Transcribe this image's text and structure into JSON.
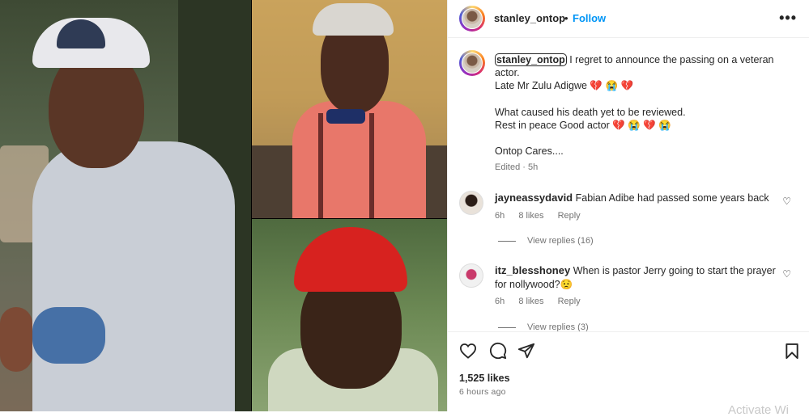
{
  "post": {
    "author": "stanley_ontop",
    "separator": "•",
    "follow_label": "Follow",
    "more_icon": "more-options-icon",
    "caption": {
      "author": "stanley_ontop",
      "line1": " I regret to announce the passing on a veteran actor.",
      "line2": "Late Mr Zulu Adigwe 💔 😭 💔",
      "line3": "What caused his death yet to be reviewed.",
      "line4": "Rest in peace Good actor 💔 😭 💔 😭",
      "line5": "Ontop Cares....",
      "meta": "Edited · 5h"
    },
    "comments": [
      {
        "user": "jayneassydavid",
        "text": "Fabian Adibe had passed some years back",
        "time": "6h",
        "likes": "8 likes",
        "reply": "Reply",
        "view_replies": "View replies (16)"
      },
      {
        "user": "itz_blesshoney",
        "text": "When is pastor Jerry going to start the prayer for nollywood?😟",
        "time": "6h",
        "likes": "8 likes",
        "reply": "Reply",
        "view_replies": "View replies (3)"
      }
    ],
    "likes_count": "1,525 likes",
    "posted": "6 hours ago"
  },
  "overlay": {
    "watermark": "Activate Wi"
  },
  "colors": {
    "accent": "#0095f6",
    "text": "#262626",
    "muted": "#737373",
    "border": "#efefef"
  }
}
